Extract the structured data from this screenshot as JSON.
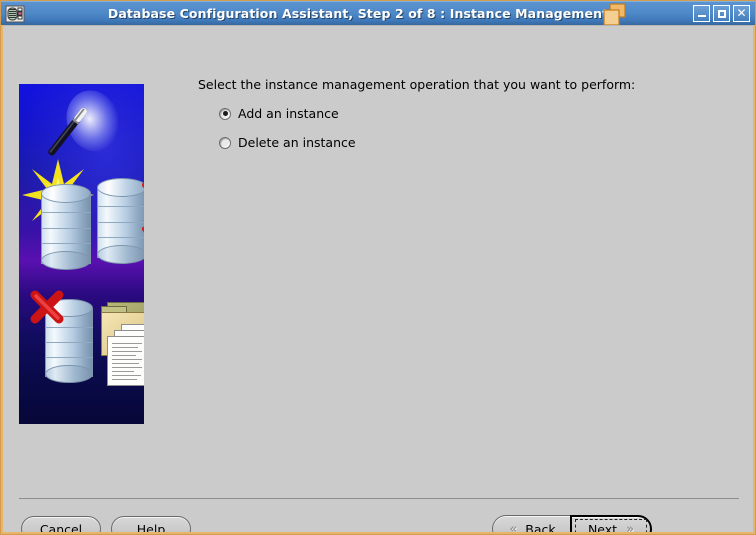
{
  "window": {
    "title": "Database Configuration Assistant, Step 2 of 8 : Instance Management",
    "app_icon": "database-app-icon",
    "cascade_icon": "cascade-windows-icon",
    "controls": {
      "minimize": "minimize-icon",
      "maximize": "maximize-icon",
      "close": "close-icon"
    },
    "colors": {
      "titlebar_start": "#5b93cf",
      "titlebar_end": "#36699f",
      "frame": "#e8b36a",
      "client_bg": "#cbcbcb",
      "graphic_bg": "#1212e0"
    }
  },
  "content": {
    "prompt": "Select the instance management operation that you want to perform:",
    "options": [
      {
        "label": "Add an instance",
        "selected": true
      },
      {
        "label": "Delete an instance",
        "selected": false
      }
    ]
  },
  "graphic": {
    "name": "wizard-database-illustration",
    "elements": [
      "magic-wand-icon",
      "starburst-icon",
      "database-cylinder-icon",
      "checkbox-list-icon",
      "red-x-icon",
      "folder-documents-icon"
    ]
  },
  "footer": {
    "cancel": "Cancel",
    "help": "Help",
    "back": {
      "label": "Back",
      "mnemonic": "B",
      "prefix": "",
      "chevron": "«",
      "enabled": false
    },
    "next": {
      "label": "Next",
      "mnemonic": "N",
      "prefix": "",
      "chevron": "»",
      "enabled": true,
      "focused": true
    }
  }
}
